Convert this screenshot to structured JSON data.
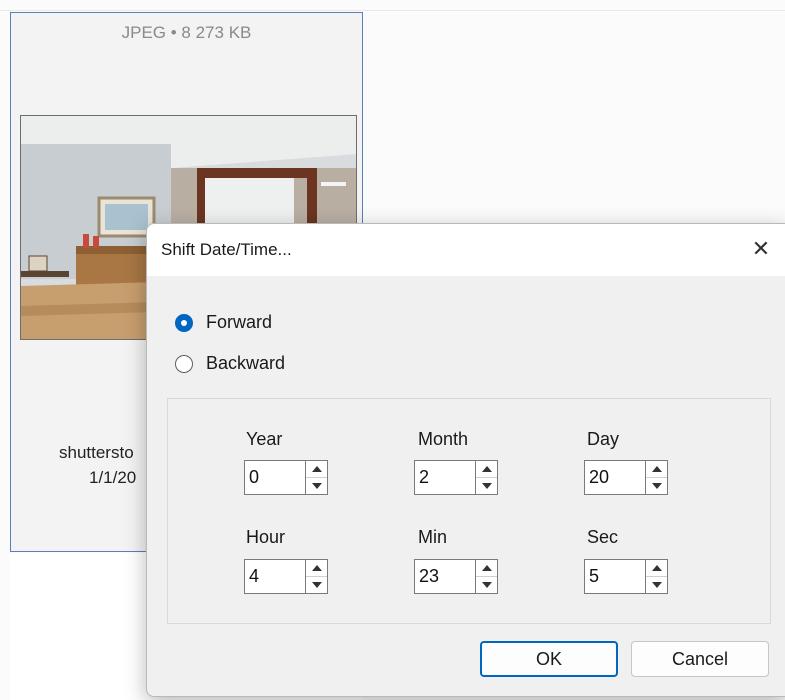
{
  "thumbnail": {
    "meta": "JPEG • 8 273 KB",
    "filename_partial": "shuttersto",
    "date_partial": "1/1/20"
  },
  "dialog": {
    "title": "Shift Date/Time...",
    "close_glyph": "✕",
    "direction": {
      "selected": "Forward",
      "options": [
        "Forward",
        "Backward"
      ]
    },
    "fields": {
      "year": {
        "label": "Year",
        "value": "0"
      },
      "month": {
        "label": "Month",
        "value": "2"
      },
      "day": {
        "label": "Day",
        "value": "20"
      },
      "hour": {
        "label": "Hour",
        "value": "4"
      },
      "min": {
        "label": "Min",
        "value": "23"
      },
      "sec": {
        "label": "Sec",
        "value": "5"
      }
    },
    "ok_label": "OK",
    "cancel_label": "Cancel"
  },
  "colors": {
    "accent": "#0067c0",
    "dialog_bg": "#f0f0f0",
    "selection_border": "#5a7fb8"
  },
  "icons": {
    "close": "close-icon",
    "spin_up": "chevron-up-icon",
    "spin_down": "chevron-down-icon"
  }
}
